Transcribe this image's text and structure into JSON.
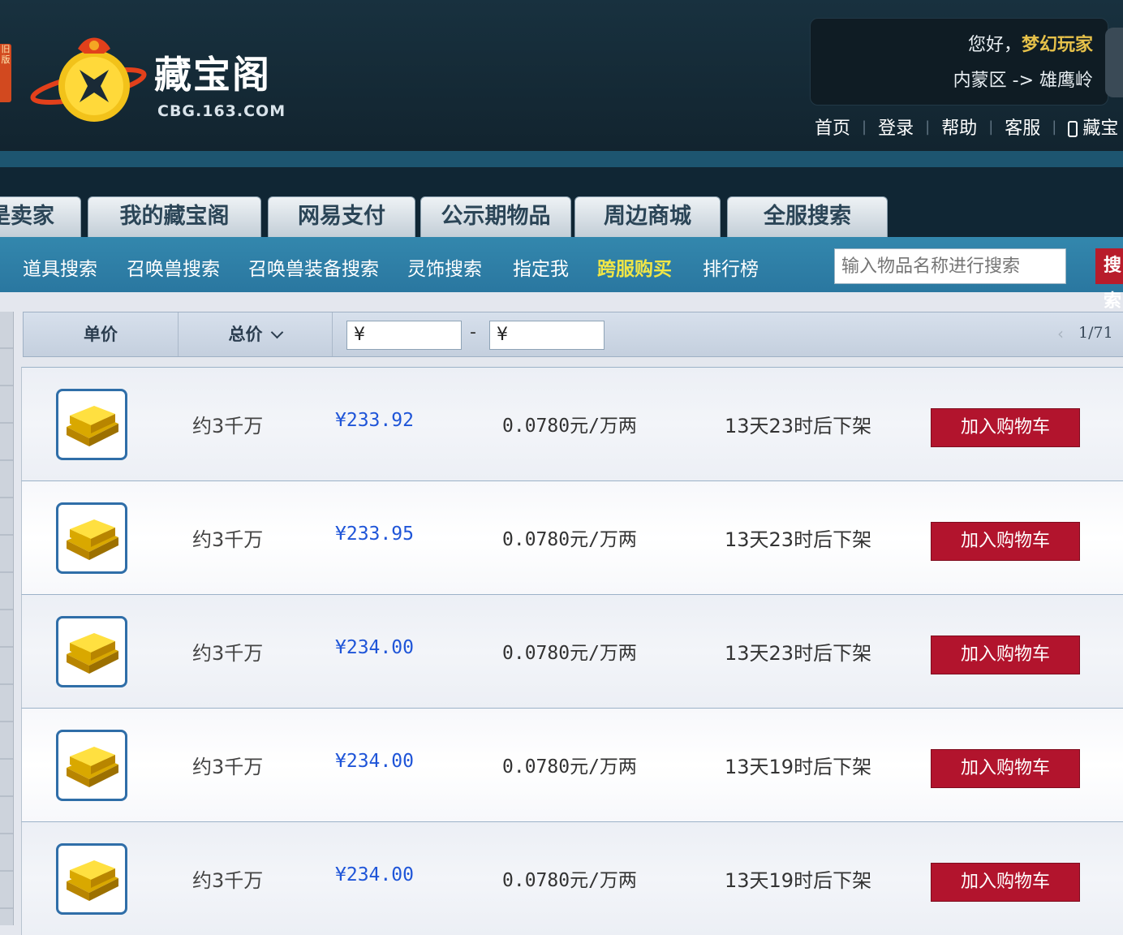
{
  "header": {
    "side_tag": "旧版",
    "logo_name": "藏宝阁",
    "logo_domain": "CBG.163.COM",
    "greeting": "您好，",
    "username": "梦幻玩家",
    "server": "内蒙区 -> 雄鹰岭",
    "links": [
      "首页",
      "登录",
      "帮助",
      "客服"
    ],
    "app_link": "藏宝"
  },
  "tabs": [
    "我是卖家",
    "我的藏宝阁",
    "网易支付",
    "公示期物品",
    "周边商城",
    "全服搜索"
  ],
  "subnav": {
    "items": [
      "道具搜索",
      "召唤兽搜索",
      "召唤兽装备搜索",
      "灵饰搜索",
      "指定我",
      "跨服购买",
      "排行榜"
    ],
    "active": "跨服购买"
  },
  "search": {
    "placeholder": "输入物品名称进行搜索",
    "button": "搜索"
  },
  "sortbar": {
    "unit_price": "单价",
    "total_price": "总价",
    "price_min_prefix": "¥",
    "price_max_prefix": "¥",
    "dash": "-",
    "prev": "‹",
    "page": "1/71"
  },
  "rows": [
    {
      "qty": "约3千万",
      "price": "¥233.92",
      "unit": "0.0780元/万两",
      "expire": "13天23时后下架",
      "button": "加入购物车"
    },
    {
      "qty": "约3千万",
      "price": "¥233.95",
      "unit": "0.0780元/万两",
      "expire": "13天23时后下架",
      "button": "加入购物车"
    },
    {
      "qty": "约3千万",
      "price": "¥234.00",
      "unit": "0.0780元/万两",
      "expire": "13天23时后下架",
      "button": "加入购物车"
    },
    {
      "qty": "约3千万",
      "price": "¥234.00",
      "unit": "0.0780元/万两",
      "expire": "13天19时后下架",
      "button": "加入购物车"
    },
    {
      "qty": "约3千万",
      "price": "¥234.00",
      "unit": "0.0780元/万两",
      "expire": "13天19时后下架",
      "button": "加入购物车"
    }
  ],
  "colors": {
    "accent_blue": "#2a7aa3",
    "cart_red": "#b2142d",
    "price_blue": "#1f55d8",
    "active_yellow": "#f0e646"
  },
  "icons": {
    "item": "gold-bars-icon",
    "logo": "treasure-bag-icon",
    "phone": "phone-icon",
    "sort": "chevron-down-icon"
  }
}
